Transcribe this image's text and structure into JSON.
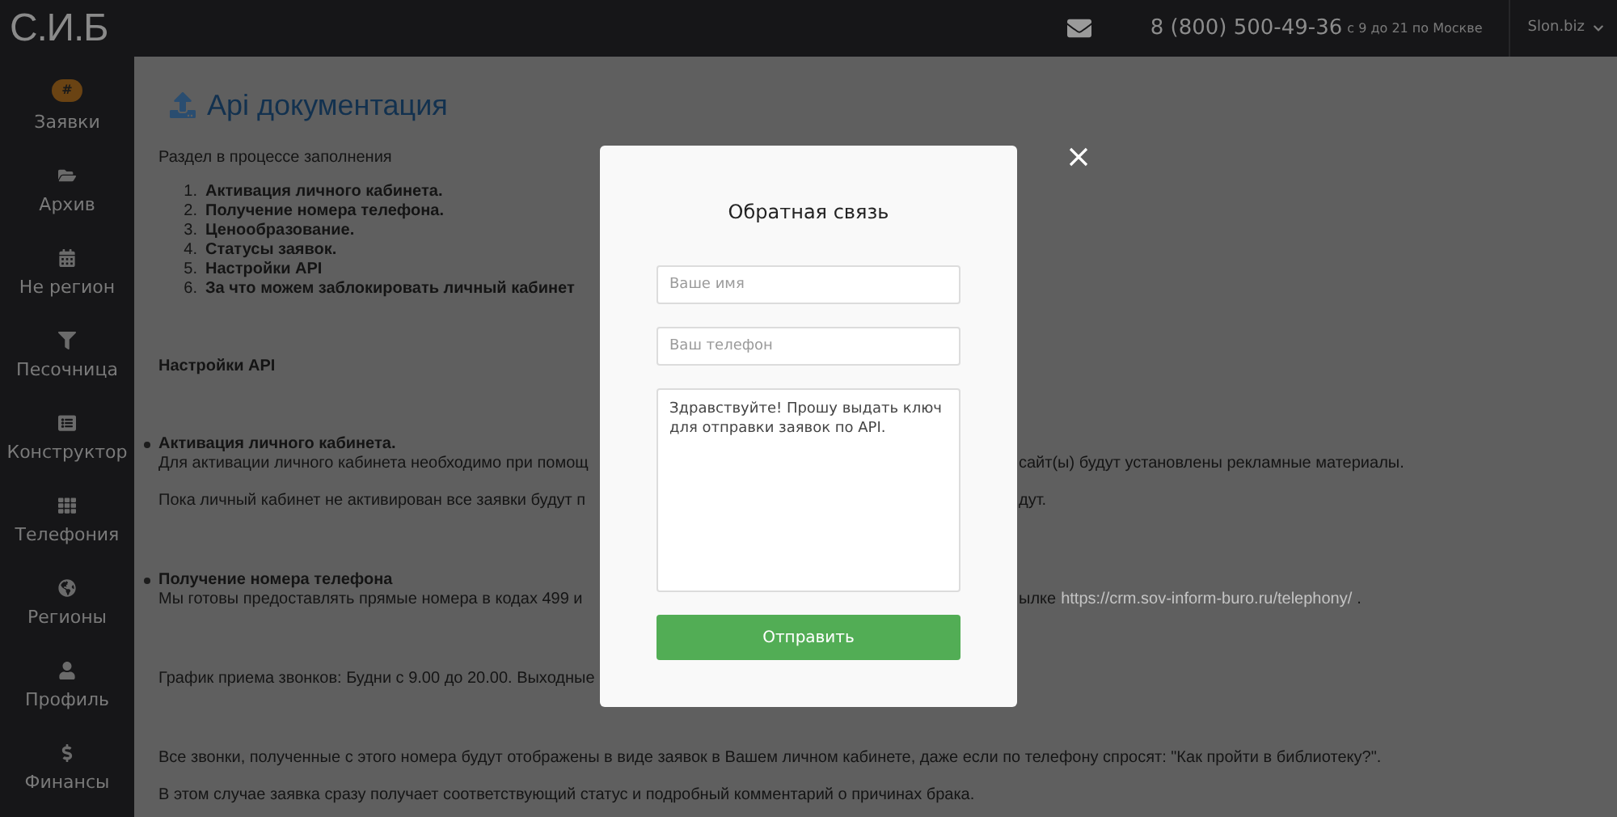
{
  "header": {
    "logo": "С.И.Б",
    "phone": "8 (800) 500-49-36",
    "hours": "с 9 до 21 по Москве",
    "account": "Slon.biz"
  },
  "sidebar": {
    "items": [
      {
        "label": "Заявки",
        "kind": "badge",
        "badge": "#"
      },
      {
        "label": "Архив",
        "kind": "folder"
      },
      {
        "label": "Не регион",
        "kind": "calendar"
      },
      {
        "label": "Песочница",
        "kind": "filter"
      },
      {
        "label": "Конструктор",
        "kind": "list"
      },
      {
        "label": "Телефония",
        "kind": "grid"
      },
      {
        "label": "Регионы",
        "kind": "globe"
      },
      {
        "label": "Профиль",
        "kind": "user"
      },
      {
        "label": "Финансы",
        "kind": "dollar"
      }
    ]
  },
  "page": {
    "title": "Api документация",
    "intro": "Раздел в процессе заполнения",
    "toc": [
      {
        "number": "1.",
        "text": "Активация личного кабинета."
      },
      {
        "number": "2.",
        "text": "Получение номера телефона."
      },
      {
        "number": "3.",
        "text": "Ценообразование."
      },
      {
        "number": "4.",
        "text": "Статусы заявок."
      },
      {
        "number": "5.",
        "text": "Настройки API"
      },
      {
        "number": "6.",
        "text": "За что можем заблокировать личный кабинет"
      }
    ],
    "section_title": "Настройки API",
    "sections": [
      {
        "heading": "Активация личного кабинета.",
        "paragraphs": [
          {
            "left": "Для активации личного кабинета необходимо при помощ",
            "right": "сайт(ы) будут установлены рекламные материалы."
          },
          {
            "left": "Пока личный кабинет не активирован все заявки будут п",
            "right": "дут."
          }
        ]
      },
      {
        "heading": "Получение номера телефона",
        "paragraphs": [
          {
            "left": "Мы готовы предоставлять прямые номера в кодах 499 и",
            "right": "ылке",
            "link": "https://crm.sov-inform-buro.ru/telephony/",
            "after": "."
          }
        ]
      },
      {
        "paragraphs": [
          {
            "left": "График приема звонков: Будни с 9.00 до 20.00. Выходные"
          }
        ]
      },
      {
        "paragraphs": [
          {
            "left": "Все звонки, полученные с этого номера будут отображены в виде заявок в Вашем личном кабинете, даже если по телефону спросят: \"Как пройти в библиотеку?\"."
          },
          {
            "left": "В этом случае заявка сразу получает соответствующий статус и подробный комментарий о причинах брака."
          }
        ]
      }
    ]
  },
  "modal": {
    "title": "Обратная связь",
    "fields": [
      {
        "placeholder": "Ваше имя"
      },
      {
        "placeholder": "Ваш телефон"
      }
    ],
    "message": "Здравствуйте! Прошу выдать ключ для отправки заявок по API.",
    "submit": "Отправить"
  }
}
